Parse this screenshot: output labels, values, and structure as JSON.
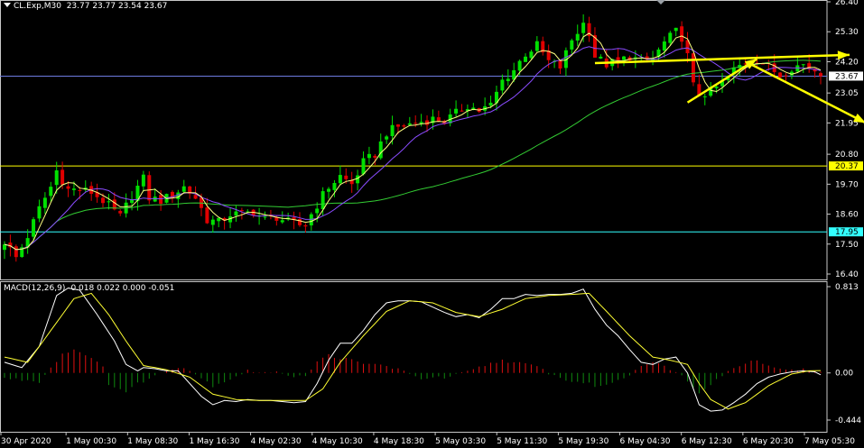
{
  "header": {
    "symbol": "CL.Exp,M30",
    "quote": "23.77 23.77 23.54 23.67"
  },
  "macd_header": "MACD(12,26,9) -0.018 0.022 0.000 -0.051",
  "colors": {
    "background": "#000000",
    "bull": "#00e000",
    "bear": "#e00000",
    "ma_fast": "#ffff80",
    "ma_mid": "#8a4cff",
    "ma_slow": "#33cc33",
    "macd_line": "#ffffff",
    "signal_line": "#ffff33",
    "hist_pos": "#e01010",
    "hist_neg": "#0f8a0f",
    "arrow": "#ffff00",
    "level_yellow": "#ffff00",
    "level_cyan": "#33ffff",
    "grid": "#c8c8c8"
  },
  "chart_data": [
    {
      "type": "candlestick",
      "title": "CL.Exp,M30",
      "y_ticks": [
        "26.40",
        "25.30",
        "24.20",
        "23.05",
        "21.95",
        "20.80",
        "19.70",
        "18.60",
        "17.50",
        "16.40"
      ],
      "ylim": [
        16.4,
        26.4
      ],
      "x_ticks": [
        "30 Apr 2020",
        "1 May 00:30",
        "1 May 08:30",
        "1 May 16:30",
        "4 May 02:30",
        "4 May 10:30",
        "4 May 18:30",
        "5 May 03:30",
        "5 May 11:30",
        "5 May 19:30",
        "6 May 04:30",
        "6 May 12:30",
        "6 May 20:30",
        "7 May 05:30"
      ],
      "price_levels": [
        {
          "value": 23.67,
          "label": "23.67",
          "style": "bid"
        },
        {
          "value": 20.37,
          "label": "20.37",
          "style": "yellow"
        },
        {
          "value": 17.95,
          "label": "17.95",
          "style": "cyan"
        }
      ],
      "close_path": [
        [
          0,
          17.6
        ],
        [
          2,
          17.0
        ],
        [
          4,
          17.8
        ],
        [
          6,
          18.8
        ],
        [
          8,
          19.6
        ],
        [
          9,
          20.2
        ],
        [
          11,
          19.5
        ],
        [
          13,
          19.5
        ],
        [
          15,
          19.4
        ],
        [
          17,
          19.1
        ],
        [
          18,
          18.9
        ],
        [
          20,
          18.5
        ],
        [
          22,
          19.3
        ],
        [
          24,
          19.9
        ],
        [
          25,
          19.2
        ],
        [
          27,
          19.1
        ],
        [
          29,
          19.3
        ],
        [
          31,
          19.6
        ],
        [
          33,
          19.2
        ],
        [
          34,
          18.8
        ],
        [
          35,
          18.4
        ],
        [
          37,
          18.3
        ],
        [
          39,
          18.6
        ],
        [
          41,
          18.6
        ],
        [
          43,
          18.7
        ],
        [
          45,
          18.4
        ],
        [
          47,
          18.5
        ],
        [
          49,
          18.3
        ],
        [
          51,
          18.2
        ],
        [
          52,
          18.2
        ],
        [
          53,
          18.6
        ],
        [
          55,
          19.3
        ],
        [
          56,
          19.6
        ],
        [
          58,
          20.0
        ],
        [
          60,
          19.7
        ],
        [
          62,
          20.5
        ],
        [
          64,
          20.8
        ],
        [
          66,
          21.6
        ],
        [
          68,
          21.8
        ],
        [
          70,
          21.9
        ],
        [
          72,
          22.0
        ],
        [
          74,
          22.1
        ],
        [
          76,
          22.0
        ],
        [
          78,
          22.3
        ],
        [
          80,
          22.6
        ],
        [
          82,
          22.4
        ],
        [
          84,
          22.6
        ],
        [
          86,
          23.5
        ],
        [
          88,
          23.9
        ],
        [
          90,
          24.5
        ],
        [
          92,
          24.8
        ],
        [
          94,
          24.2
        ],
        [
          96,
          24.0
        ],
        [
          98,
          25.0
        ],
        [
          100,
          25.6
        ],
        [
          101,
          25.3
        ],
        [
          102,
          24.4
        ],
        [
          104,
          24.1
        ],
        [
          106,
          24.2
        ],
        [
          108,
          24.4
        ],
        [
          110,
          24.2
        ],
        [
          112,
          24.3
        ],
        [
          114,
          24.9
        ],
        [
          116,
          25.3
        ],
        [
          117,
          25.1
        ],
        [
          118,
          24.4
        ],
        [
          119,
          23.3
        ],
        [
          120,
          23.0
        ],
        [
          122,
          23.1
        ],
        [
          124,
          23.4
        ],
        [
          126,
          23.9
        ],
        [
          128,
          24.2
        ],
        [
          130,
          24.3
        ],
        [
          132,
          24.0
        ],
        [
          134,
          23.7
        ],
        [
          136,
          24.0
        ],
        [
          138,
          24.1
        ],
        [
          140,
          23.9
        ],
        [
          141,
          23.67
        ]
      ],
      "annotations": [
        "horizontal resistance arrow at 24.20 pointing right",
        "rising support arrow from 6 May 12:30 to 24.30",
        "down arrow projecting below 22.00"
      ]
    },
    {
      "type": "macd",
      "title": "MACD(12,26,9)",
      "y_ticks": [
        "0.813",
        "0.00",
        "-0.444"
      ],
      "ylim": [
        -0.444,
        0.813
      ],
      "values": {
        "macd": -0.018,
        "signal": 0.022,
        "histogram": 0.0,
        "fourth": -0.051
      },
      "macd_path": [
        [
          0,
          0.1
        ],
        [
          3,
          0.05
        ],
        [
          6,
          0.25
        ],
        [
          9,
          0.73
        ],
        [
          11,
          0.8
        ],
        [
          13,
          0.78
        ],
        [
          16,
          0.55
        ],
        [
          19,
          0.3
        ],
        [
          21,
          0.08
        ],
        [
          23,
          0.02
        ],
        [
          24,
          0.05
        ],
        [
          26,
          0.04
        ],
        [
          28,
          0.02
        ],
        [
          30,
          0.02
        ],
        [
          32,
          -0.1
        ],
        [
          34,
          -0.22
        ],
        [
          36,
          -0.3
        ],
        [
          38,
          -0.26
        ],
        [
          40,
          -0.27
        ],
        [
          42,
          -0.25
        ],
        [
          44,
          -0.26
        ],
        [
          46,
          -0.26
        ],
        [
          48,
          -0.27
        ],
        [
          50,
          -0.28
        ],
        [
          52,
          -0.27
        ],
        [
          54,
          -0.1
        ],
        [
          56,
          0.12
        ],
        [
          58,
          0.28
        ],
        [
          60,
          0.28
        ],
        [
          62,
          0.4
        ],
        [
          64,
          0.55
        ],
        [
          66,
          0.66
        ],
        [
          68,
          0.68
        ],
        [
          70,
          0.68
        ],
        [
          72,
          0.67
        ],
        [
          74,
          0.62
        ],
        [
          76,
          0.57
        ],
        [
          78,
          0.53
        ],
        [
          80,
          0.55
        ],
        [
          82,
          0.52
        ],
        [
          84,
          0.6
        ],
        [
          86,
          0.7
        ],
        [
          88,
          0.7
        ],
        [
          90,
          0.74
        ],
        [
          92,
          0.73
        ],
        [
          94,
          0.74
        ],
        [
          96,
          0.74
        ],
        [
          98,
          0.75
        ],
        [
          100,
          0.79
        ],
        [
          102,
          0.6
        ],
        [
          104,
          0.45
        ],
        [
          106,
          0.35
        ],
        [
          108,
          0.22
        ],
        [
          110,
          0.1
        ],
        [
          112,
          0.08
        ],
        [
          114,
          0.13
        ],
        [
          116,
          0.15
        ],
        [
          118,
          0.0
        ],
        [
          119,
          -0.15
        ],
        [
          120,
          -0.3
        ],
        [
          122,
          -0.36
        ],
        [
          124,
          -0.35
        ],
        [
          126,
          -0.28
        ],
        [
          128,
          -0.2
        ],
        [
          130,
          -0.1
        ],
        [
          132,
          -0.04
        ],
        [
          134,
          -0.01
        ],
        [
          136,
          0.01
        ],
        [
          138,
          0.02
        ],
        [
          140,
          0.01
        ],
        [
          141,
          -0.018
        ]
      ],
      "signal_path": [
        [
          0,
          0.15
        ],
        [
          4,
          0.1
        ],
        [
          8,
          0.4
        ],
        [
          12,
          0.7
        ],
        [
          15,
          0.75
        ],
        [
          18,
          0.55
        ],
        [
          21,
          0.3
        ],
        [
          24,
          0.07
        ],
        [
          28,
          0.03
        ],
        [
          32,
          -0.04
        ],
        [
          36,
          -0.2
        ],
        [
          40,
          -0.25
        ],
        [
          44,
          -0.26
        ],
        [
          48,
          -0.26
        ],
        [
          52,
          -0.26
        ],
        [
          55,
          -0.15
        ],
        [
          58,
          0.1
        ],
        [
          62,
          0.35
        ],
        [
          66,
          0.58
        ],
        [
          70,
          0.68
        ],
        [
          74,
          0.66
        ],
        [
          78,
          0.57
        ],
        [
          82,
          0.53
        ],
        [
          86,
          0.6
        ],
        [
          90,
          0.7
        ],
        [
          94,
          0.73
        ],
        [
          98,
          0.74
        ],
        [
          101,
          0.75
        ],
        [
          104,
          0.58
        ],
        [
          108,
          0.35
        ],
        [
          112,
          0.15
        ],
        [
          115,
          0.12
        ],
        [
          118,
          0.08
        ],
        [
          120,
          -0.1
        ],
        [
          122,
          -0.25
        ],
        [
          125,
          -0.34
        ],
        [
          128,
          -0.28
        ],
        [
          132,
          -0.12
        ],
        [
          136,
          -0.01
        ],
        [
          139,
          0.02
        ],
        [
          141,
          0.022
        ]
      ],
      "histogram_path": [
        [
          0,
          -0.05
        ],
        [
          6,
          -0.08
        ],
        [
          8,
          0.05
        ],
        [
          10,
          0.18
        ],
        [
          12,
          0.22
        ],
        [
          14,
          0.18
        ],
        [
          17,
          0.05
        ],
        [
          18,
          -0.1
        ],
        [
          21,
          -0.18
        ],
        [
          23,
          -0.1
        ],
        [
          26,
          -0.03
        ],
        [
          28,
          0.03
        ],
        [
          30,
          0.06
        ],
        [
          32,
          0.03
        ],
        [
          34,
          -0.05
        ],
        [
          36,
          -0.12
        ],
        [
          38,
          -0.08
        ],
        [
          40,
          -0.03
        ],
        [
          42,
          0.02
        ],
        [
          44,
          0.01
        ],
        [
          46,
          0.0
        ],
        [
          48,
          0.0
        ],
        [
          50,
          -0.03
        ],
        [
          52,
          -0.02
        ],
        [
          54,
          0.1
        ],
        [
          56,
          0.17
        ],
        [
          58,
          0.14
        ],
        [
          60,
          0.12
        ],
        [
          62,
          0.08
        ],
        [
          64,
          0.09
        ],
        [
          66,
          0.06
        ],
        [
          68,
          0.04
        ],
        [
          70,
          -0.02
        ],
        [
          72,
          -0.05
        ],
        [
          74,
          -0.04
        ],
        [
          76,
          -0.05
        ],
        [
          78,
          -0.02
        ],
        [
          80,
          0.01
        ],
        [
          82,
          0.05
        ],
        [
          84,
          0.09
        ],
        [
          86,
          0.12
        ],
        [
          88,
          0.1
        ],
        [
          90,
          0.08
        ],
        [
          92,
          0.06
        ],
        [
          94,
          0.0
        ],
        [
          96,
          -0.05
        ],
        [
          98,
          -0.08
        ],
        [
          100,
          -0.09
        ],
        [
          102,
          -0.12
        ],
        [
          104,
          -0.12
        ],
        [
          106,
          -0.06
        ],
        [
          108,
          -0.02
        ],
        [
          110,
          0.08
        ],
        [
          112,
          0.1
        ],
        [
          114,
          0.06
        ],
        [
          116,
          0.02
        ],
        [
          118,
          -0.08
        ],
        [
          120,
          -0.18
        ],
        [
          122,
          -0.1
        ],
        [
          124,
          -0.02
        ],
        [
          126,
          0.04
        ],
        [
          128,
          0.1
        ],
        [
          130,
          0.12
        ],
        [
          132,
          0.08
        ],
        [
          134,
          0.03
        ],
        [
          136,
          0.04
        ],
        [
          138,
          0.03
        ],
        [
          140,
          0.01
        ],
        [
          141,
          0.0
        ]
      ]
    }
  ]
}
